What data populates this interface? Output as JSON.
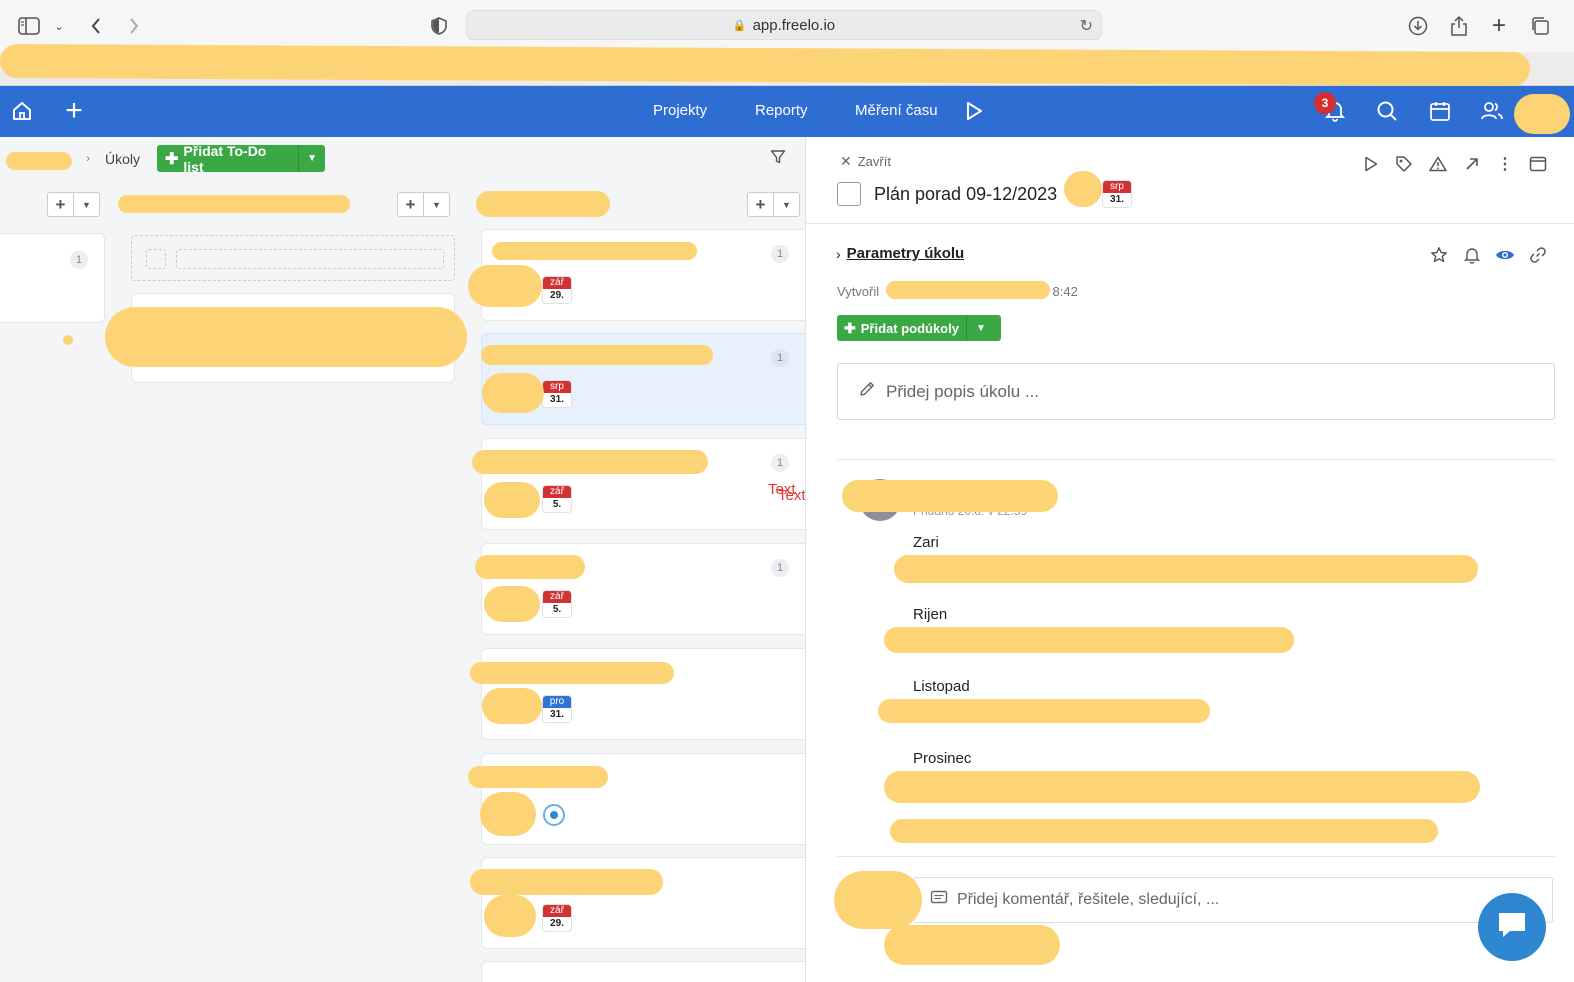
{
  "browser": {
    "url": "app.freelo.io"
  },
  "header": {
    "nav": [
      "Projekty",
      "Reporty",
      "Měření času"
    ],
    "notifications_count": "3"
  },
  "breadcrumb": {
    "current": "Úkoly"
  },
  "toolbar": {
    "add_todo_label": "Přidat To-Do list"
  },
  "board": {
    "column1_count": "1",
    "cards": [
      {
        "count": "1",
        "month": "zář",
        "day": "29.",
        "color": "#d23232"
      },
      {
        "count": "1",
        "month": "srp",
        "day": "31.",
        "color": "#d23232"
      },
      {
        "count": "1",
        "month": "zář",
        "day": "5.",
        "color": "#d23232"
      },
      {
        "count": "1",
        "month": "zář",
        "day": "5.",
        "color": "#d23232"
      },
      {
        "count": "",
        "month": "pro",
        "day": "31.",
        "color": "#2f73d4"
      },
      {
        "count": "",
        "month": "",
        "day": "",
        "color": ""
      },
      {
        "count": "",
        "month": "zář",
        "day": "29.",
        "color": "#d23232"
      }
    ],
    "annotation": "Text"
  },
  "detail": {
    "close_label": "Zavřít",
    "task_title": "Plán porad 09-12/2023",
    "task_due": {
      "month": "srp",
      "day": "31."
    },
    "params_label": "Parametry úkolu",
    "created_prefix": "Vytvořil",
    "created_suffix": "v 8:42",
    "add_subtask_label": "Přidat podúkoly",
    "description_placeholder": "Přidej popis úkolu ...",
    "comment_meta": "Přidáno 20.8. v 22:59",
    "months": [
      "Zari",
      "Rijen",
      "Listopad",
      "Prosinec"
    ],
    "comment_placeholder": "Přidej komentář, řešitele, sledující, ..."
  },
  "colors": {
    "header_blue": "#2e6dd1",
    "button_green": "#3aa845",
    "date_red": "#d23232",
    "date_blue": "#2f73d4"
  }
}
